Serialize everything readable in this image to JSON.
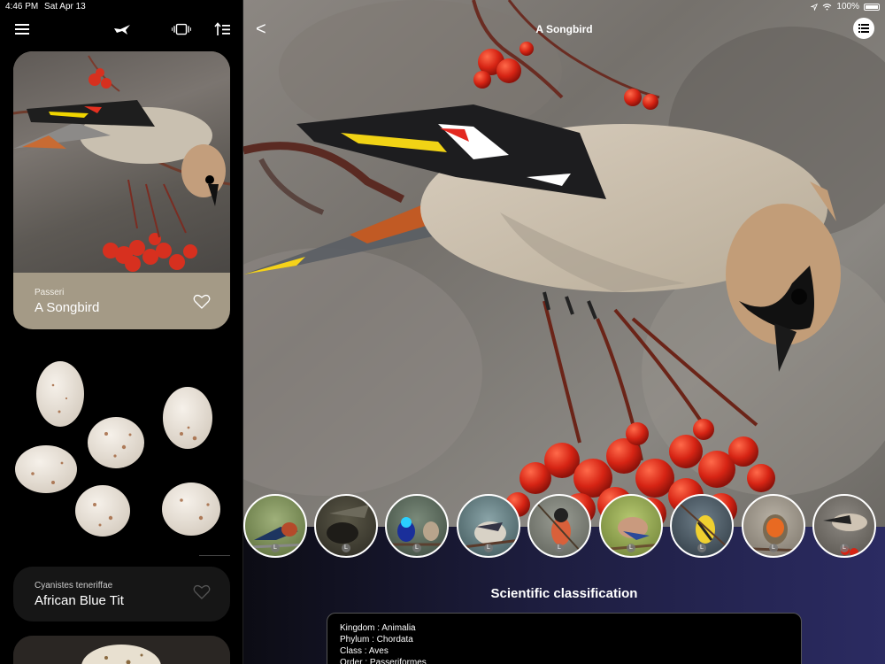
{
  "status": {
    "time": "4:46 PM",
    "date": "Sat Apr 13",
    "battery": "100%"
  },
  "sidebar": {
    "icons": [
      "menu-icon",
      "bird-logo-icon",
      "carousel-icon",
      "sort-icon"
    ],
    "cards": [
      {
        "subtitle": "Passeri",
        "title": "A Songbird"
      },
      {
        "subtitle": "Cyanistes teneriffae",
        "title": "African Blue Tit"
      }
    ]
  },
  "main": {
    "title": "A Songbird",
    "back_label": "<",
    "thumb_badge": "L",
    "section_title": "Scientific classification",
    "classification": [
      "Kingdom : Animalia",
      "Phylum : Chordata",
      "Class : Aves",
      "Order : Passeriformes"
    ]
  },
  "colors": {
    "card_accent": "#a49a86",
    "panel_purple": "#2b2b62"
  }
}
